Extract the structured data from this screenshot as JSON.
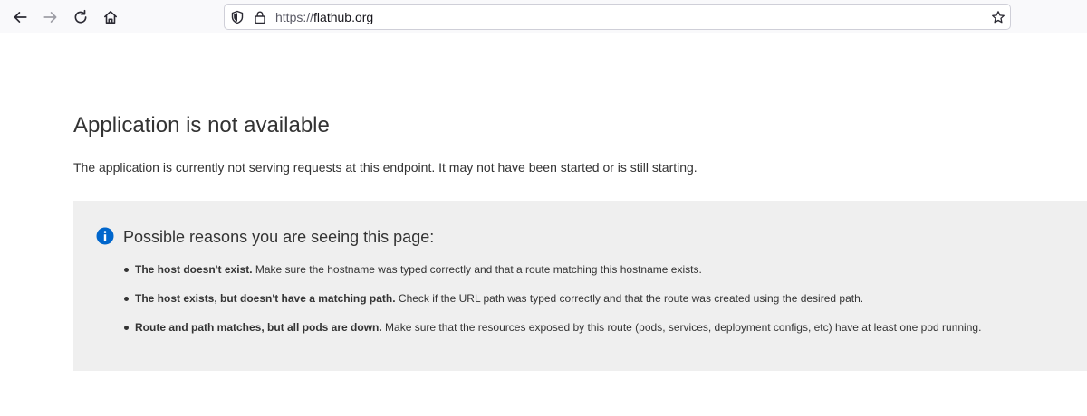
{
  "browser": {
    "url_scheme": "https://",
    "url_host": "flathub.org",
    "icons": {
      "back": "arrow-left-icon",
      "forward": "arrow-right-icon",
      "reload": "reload-icon",
      "home": "home-icon",
      "tracking": "shield-icon",
      "security": "lock-icon",
      "bookmark": "star-icon"
    }
  },
  "page": {
    "title": "Application is not available",
    "description": "The application is currently not serving requests at this endpoint. It may not have been started or is still starting.",
    "reasons_heading": "Possible reasons you are seeing this page:",
    "reasons": [
      {
        "bold": "The host doesn't exist.",
        "text": " Make sure the hostname was typed correctly and that a route matching this hostname exists."
      },
      {
        "bold": "The host exists, but doesn't have a matching path.",
        "text": " Check if the URL path was typed correctly and that the route was created using the desired path."
      },
      {
        "bold": "Route and path matches, but all pods are down.",
        "text": " Make sure that the resources exposed by this route (pods, services, deployment configs, etc) have at least one pod running."
      }
    ]
  },
  "colors": {
    "panel_background": "#efefef",
    "info_icon": "#0066cc",
    "text": "#333333"
  }
}
